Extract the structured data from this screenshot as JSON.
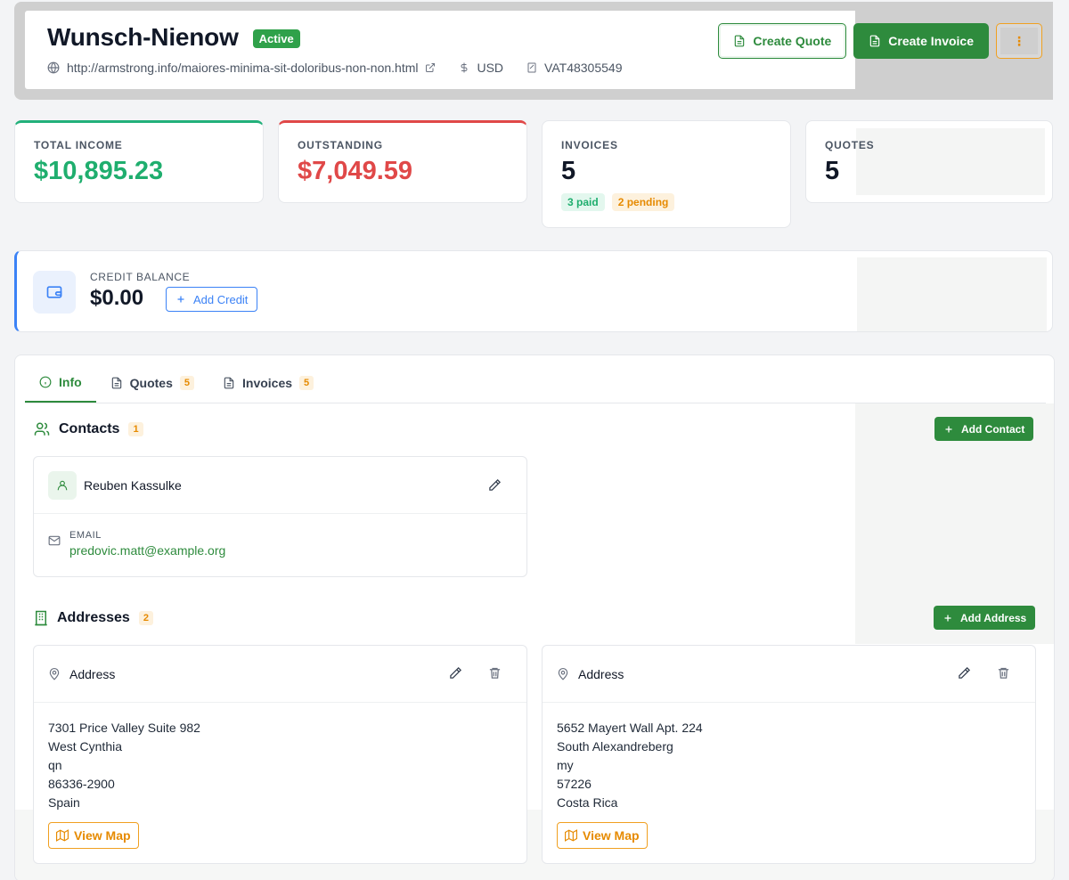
{
  "client": {
    "name": "Wunsch-Nienow",
    "status": "Active",
    "url": "http://armstrong.info/maiores-minima-sit-doloribus-non-non.html",
    "currency": "USD",
    "vat": "VAT48305549"
  },
  "header_actions": {
    "create_quote": "Create Quote",
    "create_invoice": "Create Invoice"
  },
  "stats": {
    "total_income": {
      "label": "TOTAL INCOME",
      "value": "$10,895.23"
    },
    "outstanding": {
      "label": "OUTSTANDING",
      "value": "$7,049.59"
    },
    "invoices": {
      "label": "INVOICES",
      "value": "5",
      "paid": "3 paid",
      "pending": "2 pending"
    },
    "quotes": {
      "label": "QUOTES",
      "value": "5"
    }
  },
  "credit": {
    "label": "CREDIT BALANCE",
    "value": "$0.00",
    "add_label": "Add Credit"
  },
  "tabs": [
    {
      "label": "Info"
    },
    {
      "label": "Quotes",
      "count": "5"
    },
    {
      "label": "Invoices",
      "count": "5"
    }
  ],
  "contacts": {
    "title": "Contacts",
    "count": "1",
    "add_label": "Add Contact",
    "items": [
      {
        "name": "Reuben Kassulke",
        "email_label": "EMAIL",
        "email": "predovic.matt@example.org"
      }
    ]
  },
  "addresses": {
    "title": "Addresses",
    "count": "2",
    "add_label": "Add Address",
    "items": [
      {
        "title": "Address",
        "lines": [
          "7301 Price Valley Suite 982",
          "West Cynthia",
          "qn",
          "86336-2900",
          "Spain"
        ],
        "map_label": "View Map"
      },
      {
        "title": "Address",
        "lines": [
          "5652 Mayert Wall Apt. 224",
          "South Alexandreberg",
          "my",
          "57226",
          "Costa Rica"
        ],
        "map_label": "View Map"
      }
    ]
  },
  "colors": {
    "primary_green": "#2e8b3d",
    "income_green": "#1fae6e",
    "outstanding_red": "#e04848",
    "credit_blue": "#3b82f6",
    "warning_orange": "#e68a00"
  }
}
